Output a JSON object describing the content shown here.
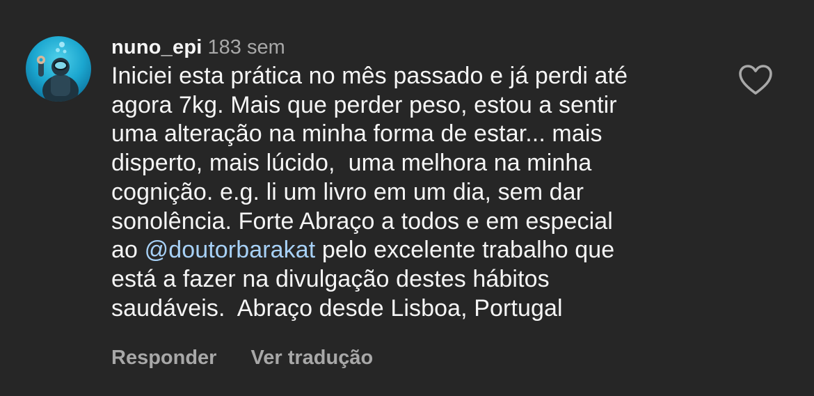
{
  "comment": {
    "username": "nuno_epi",
    "time": "183 sem",
    "lines": [
      {
        "text": "Iniciei esta prática no mês passado e já perdi até"
      },
      {
        "text": "agora 7kg. Mais que perder peso, estou a sentir"
      },
      {
        "text": "uma alteração na minha forma de estar... mais"
      },
      {
        "text": "disperto, mais lúcido,  uma melhora na minha"
      },
      {
        "text": "cognição. e.g. li um livro em um dia, sem dar"
      },
      {
        "text": "sonolência. Forte Abraço a todos e em especial"
      },
      {
        "before": "ao ",
        "mention": "@doutorbarakat",
        "after": " pelo excelente trabalho que"
      },
      {
        "text": "está a fazer na divulgação destes hábitos"
      },
      {
        "text": "saudáveis.  Abraço desde Lisboa, Portugal"
      }
    ],
    "actions": {
      "reply": "Responder",
      "translate": "Ver tradução"
    },
    "icons": {
      "like": "heart-outline-icon",
      "avatar": "diver-avatar"
    }
  },
  "colors": {
    "background": "#262626",
    "text": "#f5f5f5",
    "secondary": "#a8a8a8",
    "mention": "#a7d1f7"
  }
}
